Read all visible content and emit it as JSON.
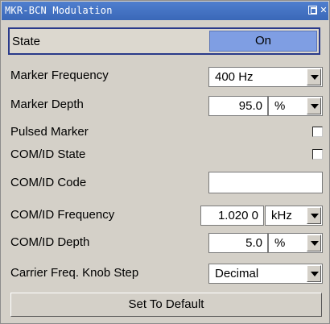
{
  "window": {
    "title": "MKR-BCN Modulation"
  },
  "state": {
    "label": "State",
    "value": "On"
  },
  "rows": {
    "marker_frequency": {
      "label": "Marker Frequency",
      "value": "400 Hz"
    },
    "marker_depth": {
      "label": "Marker Depth",
      "value": "95.0",
      "unit": "%"
    },
    "pulsed_marker": {
      "label": "Pulsed Marker",
      "checked": false
    },
    "comid_state": {
      "label": "COM/ID State",
      "checked": false
    },
    "comid_code": {
      "label": "COM/ID Code",
      "value": ""
    },
    "comid_frequency": {
      "label": "COM/ID Frequency",
      "value": "1.020 0",
      "unit": "kHz"
    },
    "comid_depth": {
      "label": "COM/ID Depth",
      "value": "5.0",
      "unit": "%"
    },
    "knob_step": {
      "label": "Carrier Freq. Knob Step",
      "value": "Decimal"
    }
  },
  "buttons": {
    "set_default": "Set To Default"
  }
}
